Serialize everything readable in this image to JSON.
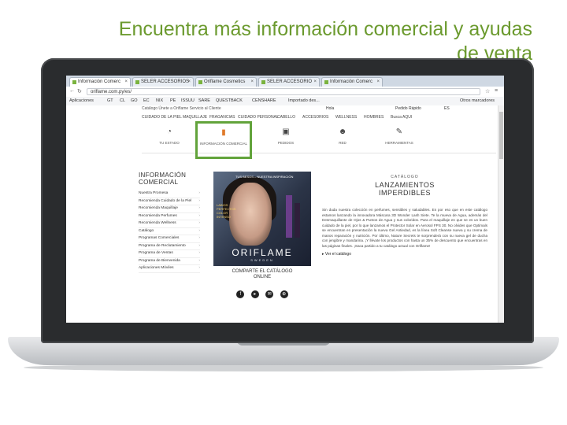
{
  "slide": {
    "title_line1": "Encuentra más información comercial y ayudas",
    "title_line2": "de venta"
  },
  "browser": {
    "tabs": [
      "Información Comerc",
      "SELER ACCESORIOS",
      "Oriflame Cosmetics",
      "SELER ACCESORIO",
      "Información Comerc"
    ],
    "url": "oriflame.com.py/es/",
    "bookmarks": [
      "Aplicaciones",
      "GT",
      "CL",
      "GO",
      "EC",
      "NIX",
      "PE",
      "ISSUU",
      "SARE",
      "QUESTBACK",
      "CENSHARE",
      "Importado des...",
      "Otros marcadores"
    ]
  },
  "site": {
    "topline": "Catálogo     Únete a Oriflame     Servicio al Cliente",
    "account": [
      "Hola",
      "Pedido Rápido",
      "ES"
    ],
    "nav": [
      "CUIDADO DE LA PIEL",
      "MAQUILLAJE",
      "FRAGANCIAS",
      "CUIDADO PERSONAL",
      "CABELLO",
      "ACCESORIOS",
      "WELLNESS",
      "HOMBRES",
      "Busca AQUI"
    ],
    "icons": [
      {
        "label": "TU ESTADO",
        "icon": "gauge-icon"
      },
      {
        "label": "INFORMACIÓN COMERCIAL",
        "icon": "lipstick-icon"
      },
      {
        "label": "PEDIDOS",
        "icon": "bag-icon"
      },
      {
        "label": "RED",
        "icon": "people-icon"
      },
      {
        "label": "HERRAMIENTAS",
        "icon": "tools-icon"
      }
    ],
    "sidebar": {
      "heading_line1": "INFORMACIÓN",
      "heading_line2": "COMERCIAL",
      "items": [
        "Nuestra Promesa",
        "Recomienda Cuidado de la Piel",
        "Recomienda Maquillaje",
        "Recomienda Perfumes",
        "Recomienda Wellness",
        "Catálogo",
        "Programas Comerciales",
        "Programa de Reclutamiento",
        "Programa de Ventas",
        "Programa de Bienvenida",
        "Aplicaciones Móviles"
      ]
    },
    "cover": {
      "tagline": "TUS BESOS – NUESTRA INSPIRACIÓN",
      "side_text": "LABIOS\nPERFECTOS\nCOLOR\nINTENSO",
      "brand": "ORIFLAME",
      "sub": "SWEDEN"
    },
    "share": {
      "text_line1": "COMPARTE EL CATÁLOGO",
      "text_line2": "ONLINE"
    },
    "article": {
      "kicker": "CATÁLOGO",
      "title_line1": "LANZAMIENTOS",
      "title_line2": "IMPERDIBLES",
      "body": "Sin duda nuestra colección en perfumes, sensibles y saludables. Es por eso que en este catálogo estamos lanzando la innovadora Máscara 3D Wonder Lash Siete. Te la mueva de Agua, además del Desmaquillante de Ojos & Puntos de Agua y sus coloridos. Para el maquillaje en que se es un buen cuidado de la piel, por lo que lanzamos el Protector Solar en Aerosol FPS 30. No olvides que Optimals se encuentran en presentación la nueva Gel Antiedad, es la línea Soft Cleanse nueva y su crema de manos reparación y nutrición. Por último, Nature Secrets te sorprenderá con su nueva gel de ducha con jengibre y mandarina. ¡Y llévate los productos con hasta un 35% de descuento que encuentras en las páginas finales. ¡Saca partido a tu catálogo actual con Oriflame!",
      "link": "Ver el catálogo"
    }
  }
}
